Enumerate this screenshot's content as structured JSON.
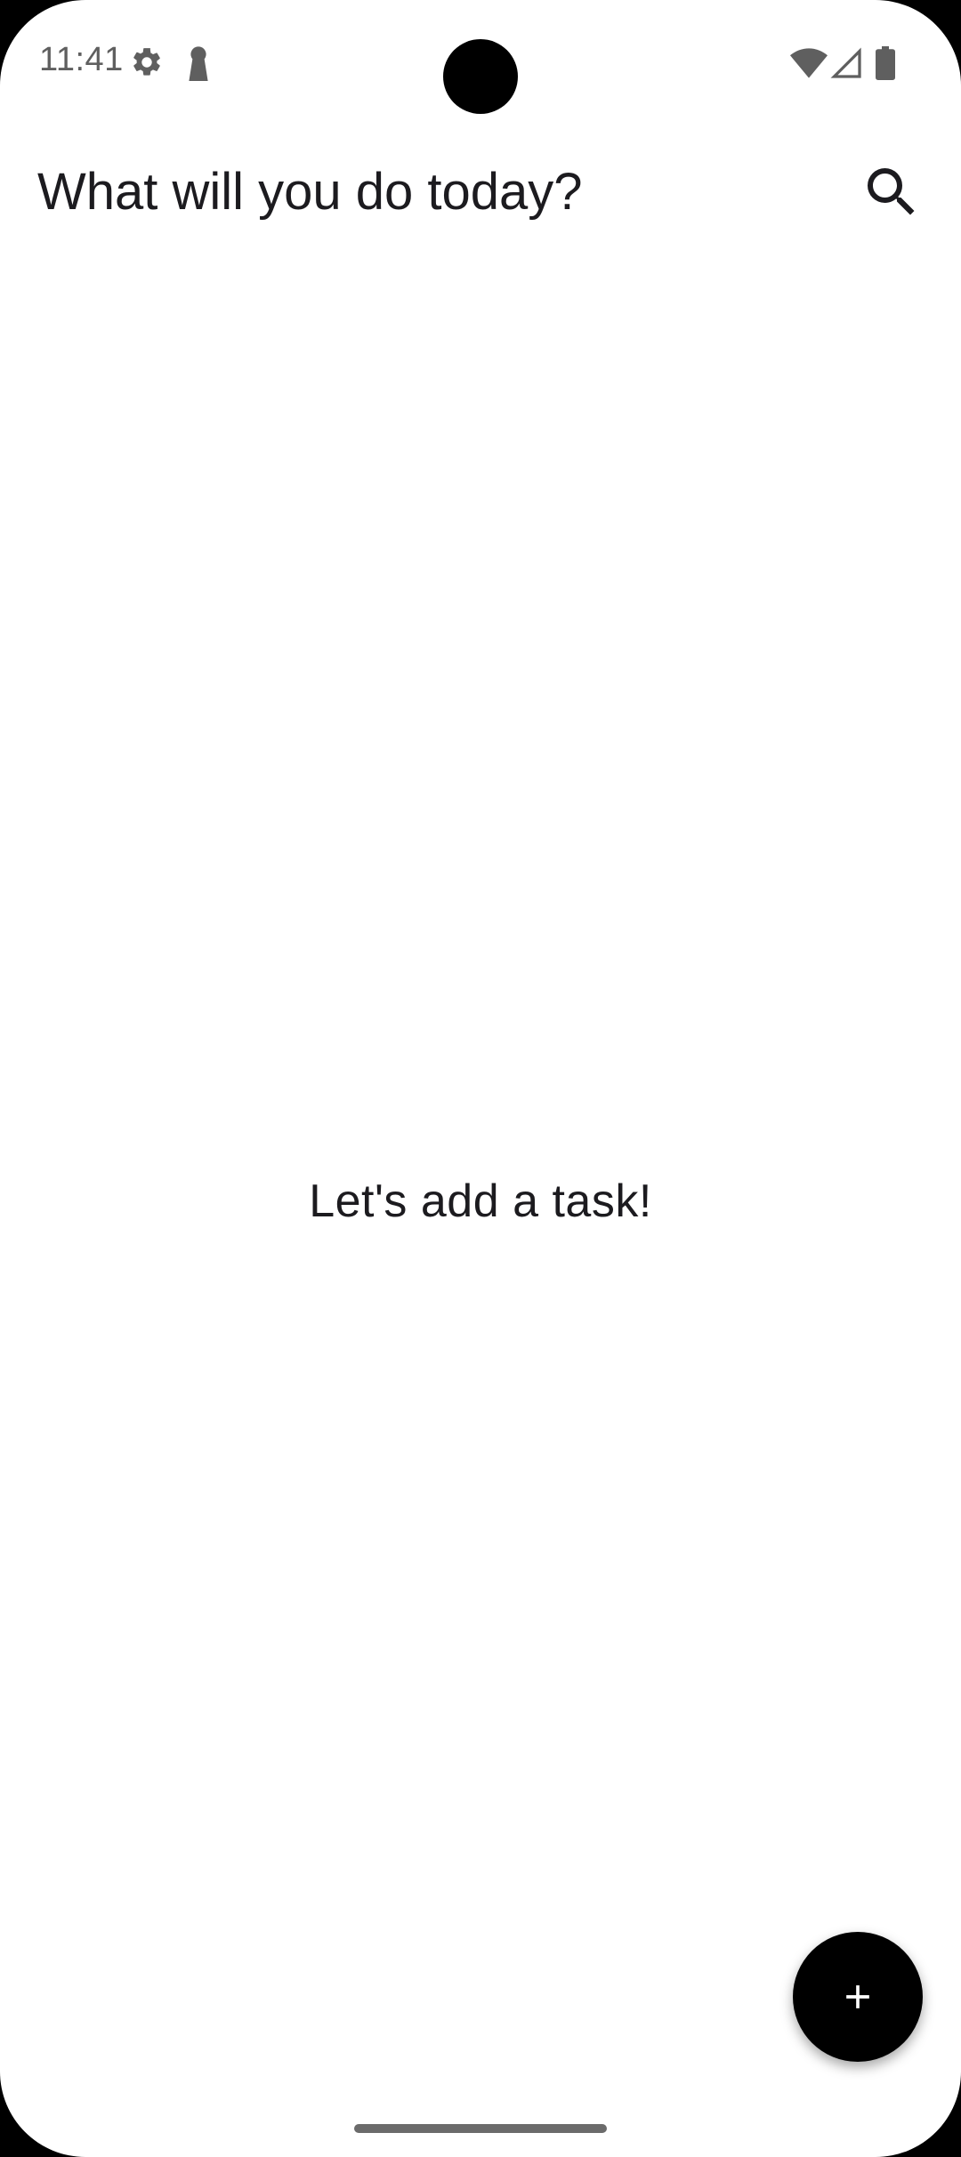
{
  "status_bar": {
    "time": "11:41",
    "icons": [
      "settings-gear-icon",
      "keyhole-icon",
      "wifi-icon",
      "cellular-signal-icon",
      "battery-icon"
    ]
  },
  "app_bar": {
    "title": "What will you do today?",
    "search_icon": "search-icon"
  },
  "main": {
    "empty_message": "Let's add a task!"
  },
  "fab": {
    "icon": "plus-icon",
    "color": "#000000"
  },
  "colors": {
    "background": "#ffffff",
    "text": "#1c1b1f",
    "status_text": "#5f5f5f"
  }
}
